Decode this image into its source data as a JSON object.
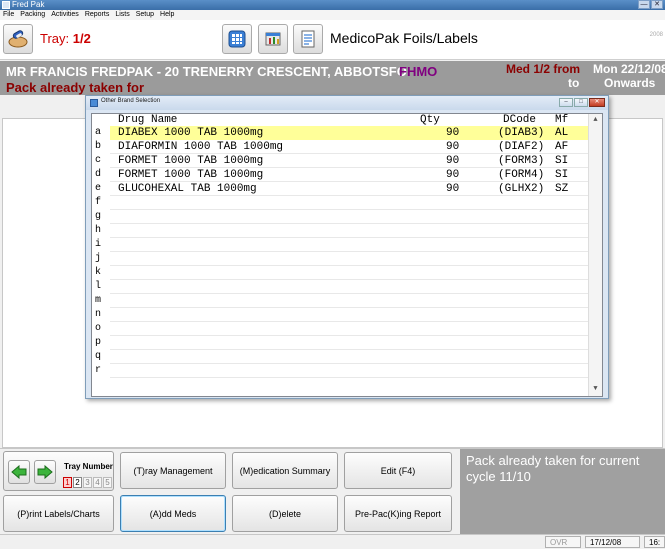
{
  "window": {
    "title": "Fred Pak",
    "controls": {
      "minimize": "—",
      "close": "✕"
    }
  },
  "menu": [
    "File",
    "Packing",
    "Activities",
    "Reports",
    "Lists",
    "Setup",
    "Help"
  ],
  "toolbar": {
    "tray_prefix": "Tray: ",
    "tray_value": "1/2",
    "module_title": "MedicoPak Foils/Labels",
    "year": "2008"
  },
  "patient": {
    "name": "MR FRANCIS FREDPAK - 20 TRENERRY CRESCENT, ABBOTSFO",
    "code": "FHMO",
    "pack_status": "Pack already taken for",
    "med_from": "Med 1/2 from",
    "med_to": "to",
    "date_start": "Mon 22/12/08",
    "date_onwards": "Onwards"
  },
  "dialog": {
    "title": "Other Brand Selection",
    "controls": {
      "minimize": "–",
      "maximize": "□",
      "close": "✕"
    },
    "columns": {
      "name": "Drug Name",
      "qty": "Qty",
      "code": "DCode",
      "mf": "Mf"
    },
    "letters": [
      "a",
      "b",
      "c",
      "d",
      "e",
      "f",
      "g",
      "h",
      "i",
      "j",
      "k",
      "l",
      "m",
      "n",
      "o",
      "p",
      "q",
      "r"
    ],
    "rows": [
      {
        "name": "DIABEX 1000 TAB 1000mg",
        "qty": "90",
        "code": "(DIAB3)",
        "mf": "AL"
      },
      {
        "name": "DIAFORMIN 1000 TAB 1000mg",
        "qty": "90",
        "code": "(DIAF2)",
        "mf": "AF"
      },
      {
        "name": "FORMET 1000 TAB 1000mg",
        "qty": "90",
        "code": "(FORM3)",
        "mf": "SI"
      },
      {
        "name": "FORMET 1000 TAB 1000mg",
        "qty": "90",
        "code": "(FORM4)",
        "mf": "SI"
      },
      {
        "name": "GLUCOHEXAL TAB 1000mg",
        "qty": "90",
        "code": "(GLHX2)",
        "mf": "SZ"
      }
    ],
    "selected_row": 0
  },
  "bottom": {
    "tray_number_label": "Tray Number",
    "tray_numbers": [
      "1",
      "2",
      "3",
      "4",
      "5"
    ],
    "tray_current": "1",
    "tray_count": 2,
    "buttons": {
      "tray_management": "(T)ray Management",
      "medication_summary": "(M)edication Summary",
      "edit": "Edit (F4)",
      "print_labels": "(P)rint Labels/Charts",
      "add_meds": "(A)dd Meds",
      "delete": "(D)elete",
      "pre_pack_report": "Pre-Pac(K)ing Report"
    },
    "status_message": "Pack already taken for current cycle 11/10"
  },
  "statusbar": {
    "mode": "OVR",
    "date": "17/12/08",
    "time": "16:"
  },
  "colors": {
    "accent_red": "#cc0000",
    "header_gray": "#9b9b9b",
    "selected_row": "#ffff99",
    "patient_code": "#800080"
  }
}
